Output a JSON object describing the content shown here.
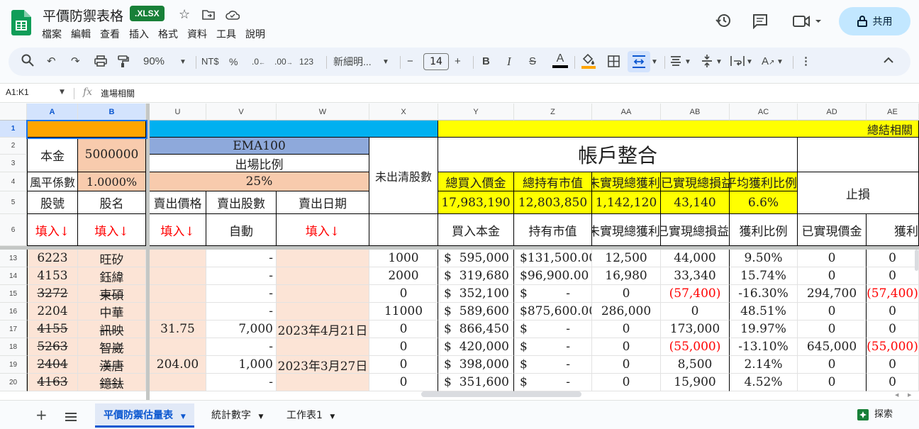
{
  "doc": {
    "title": "平價防禦表格",
    "badge": ".XLSX",
    "share_label": "共用"
  },
  "menu": [
    "檔案",
    "編輯",
    "查看",
    "插入",
    "格式",
    "資料",
    "工具",
    "說明"
  ],
  "toolbar": {
    "zoom": "90%",
    "currency": "NT$",
    "percent": "%",
    "dec_decrease": ".0",
    "dec_increase": ".00",
    "number_format": "123",
    "font": "新細明...",
    "font_size": "14"
  },
  "formula_bar": {
    "name_box": "A1:K1",
    "fx": "fx",
    "content": "進場相關"
  },
  "columns": [
    "A",
    "B",
    "U",
    "V",
    "W",
    "X",
    "Y",
    "Z",
    "AA",
    "AB",
    "AC",
    "AD",
    "AE"
  ],
  "row_numbers": [
    "1",
    "2",
    "3",
    "4",
    "5",
    "6",
    "13",
    "14",
    "15",
    "16",
    "17",
    "18",
    "19",
    "20"
  ],
  "header_cells": {
    "r1_summary": "總結相關",
    "principal_label": "本金",
    "principal_value": "5000000",
    "ema": "EMA100",
    "exit_ratio_label": "出場比例",
    "exit_ratio_value": "25%",
    "risk_label": "風平係數",
    "risk_value": "1.0000%",
    "unsold_shares": "未出清股數",
    "account_title": "帳戶整合",
    "stop_loss": "止損",
    "stock_code": "股號",
    "stock_name": "股名",
    "sell_price": "賣出價格",
    "sell_shares": "賣出股數",
    "sell_date": "賣出日期",
    "fill_in": "填入↓",
    "auto": "自動",
    "buy_principal": "買入本金",
    "market_value": "持有市值",
    "unrealized_total": "未實現總獲利",
    "realized_total": "已實現總損益",
    "profit_ratio": "獲利比例",
    "realized_value": "已實現價金",
    "profit_short": "獲利"
  },
  "summary_labels": [
    "總買入價金",
    "總持有市值",
    "未實現總獲利",
    "已實現總損益",
    "平均獲利比例"
  ],
  "summary_values": [
    "17,983,190",
    "12,803,850",
    "1,142,120",
    "43,140",
    "6.6%"
  ],
  "rows": [
    {
      "code": "6223",
      "name": "旺矽",
      "strike": false,
      "sell_price": "",
      "sell_shares": "-",
      "sell_date": "",
      "unsold": "1000",
      "buy": "595,000",
      "mv": "131,500.00",
      "unreal": "12,500",
      "real": "44,000",
      "real_neg": false,
      "ratio": "9.50%",
      "ad": "0",
      "ae": "0",
      "ae_neg": false
    },
    {
      "code": "4153",
      "name": "鈺緯",
      "strike": false,
      "sell_price": "",
      "sell_shares": "-",
      "sell_date": "",
      "unsold": "2000",
      "buy": "319,680",
      "mv": "96,900.00",
      "unreal": "16,980",
      "real": "33,340",
      "real_neg": false,
      "ratio": "15.74%",
      "ad": "0",
      "ae": "0",
      "ae_neg": false
    },
    {
      "code": "3272",
      "name": "東碩",
      "strike": true,
      "sell_price": "",
      "sell_shares": "-",
      "sell_date": "",
      "unsold": "0",
      "buy": "352,100",
      "mv": "-",
      "unreal": "0",
      "real": "(57,400)",
      "real_neg": true,
      "ratio": "-16.30%",
      "ad": "294,700",
      "ae": "(57,400)",
      "ae_neg": true
    },
    {
      "code": "2204",
      "name": "中華",
      "strike": false,
      "sell_price": "",
      "sell_shares": "-",
      "sell_date": "",
      "unsold": "11000",
      "buy": "589,600",
      "mv": "875,600.00",
      "unreal": "286,000",
      "real": "0",
      "real_neg": false,
      "ratio": "48.51%",
      "ad": "0",
      "ae": "0",
      "ae_neg": false
    },
    {
      "code": "4155",
      "name": "訊映",
      "strike": true,
      "sell_price": "31.75",
      "sell_shares": "7,000",
      "sell_date": "2023年4月21日",
      "unsold": "0",
      "buy": "866,450",
      "mv": "-",
      "unreal": "0",
      "real": "173,000",
      "real_neg": false,
      "ratio": "19.97%",
      "ad": "0",
      "ae": "0",
      "ae_neg": false
    },
    {
      "code": "5263",
      "name": "智崴",
      "strike": true,
      "sell_price": "",
      "sell_shares": "-",
      "sell_date": "",
      "unsold": "0",
      "buy": "420,000",
      "mv": "-",
      "unreal": "0",
      "real": "(55,000)",
      "real_neg": true,
      "ratio": "-13.10%",
      "ad": "645,000",
      "ae": "(55,000)",
      "ae_neg": true
    },
    {
      "code": "2404",
      "name": "漢唐",
      "strike": true,
      "sell_price": "204.00",
      "sell_shares": "1,000",
      "sell_date": "2023年3月27日",
      "unsold": "0",
      "buy": "398,000",
      "mv": "-",
      "unreal": "0",
      "real": "8,500",
      "real_neg": false,
      "ratio": "2.14%",
      "ad": "0",
      "ae": "0",
      "ae_neg": false
    },
    {
      "code": "4163",
      "name": "鐿鈦",
      "strike": true,
      "sell_price": "",
      "sell_shares": "-",
      "sell_date": "",
      "unsold": "0",
      "buy": "351,600",
      "mv": "-",
      "unreal": "0",
      "real": "15,900",
      "real_neg": false,
      "ratio": "4.52%",
      "ad": "0",
      "ae": "0",
      "ae_neg": false
    }
  ],
  "currency_symbol": "$",
  "sheets": [
    "平價防禦估量表",
    "統計數字",
    "工作表1"
  ],
  "explore_label": "探索"
}
